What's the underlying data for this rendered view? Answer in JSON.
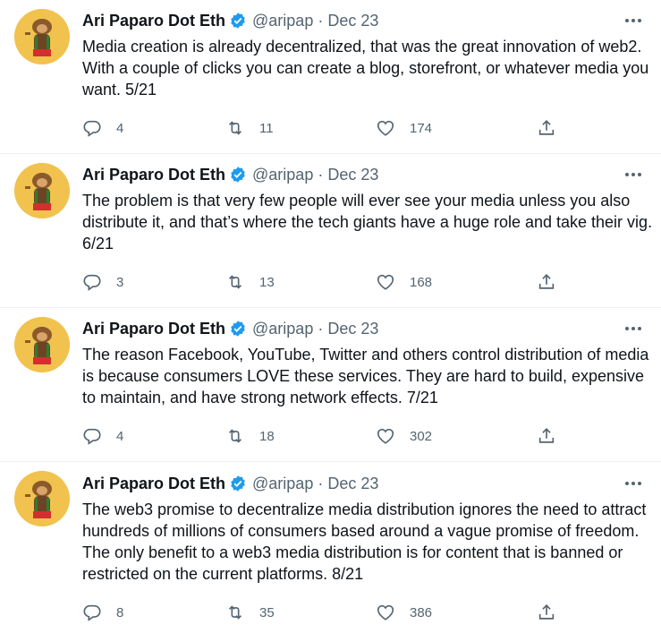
{
  "tweets": [
    {
      "name": "Ari Paparo Dot Eth",
      "handle": "@aripap",
      "separator": "·",
      "date": "Dec 23",
      "text": "Media creation is already decentralized, that was the great innovation of web2. With a couple of clicks you can create a blog, storefront, or whatever media you want. 5/21",
      "replies": "4",
      "retweets": "11",
      "likes": "174"
    },
    {
      "name": "Ari Paparo Dot Eth",
      "handle": "@aripap",
      "separator": "·",
      "date": "Dec 23",
      "text": "The problem is that very few people will ever see your media unless you also distribute it, and that’s where the tech giants have a huge role and take their vig. 6/21",
      "replies": "3",
      "retweets": "13",
      "likes": "168"
    },
    {
      "name": "Ari Paparo Dot Eth",
      "handle": "@aripap",
      "separator": "·",
      "date": "Dec 23",
      "text": "The reason Facebook, YouTube, Twitter and others control distribution of media is because consumers LOVE these services. They are hard to build, expensive to maintain, and have strong network effects. 7/21",
      "replies": "4",
      "retweets": "18",
      "likes": "302"
    },
    {
      "name": "Ari Paparo Dot Eth",
      "handle": "@aripap",
      "separator": "·",
      "date": "Dec 23",
      "text": "The web3 promise to decentralize media distribution  ignores the need to attract hundreds of millions of consumers based around a vague promise of freedom. The only benefit to a web3 media distribution is for content that is banned or restricted on the current platforms. 8/21",
      "replies": "8",
      "retweets": "35",
      "likes": "386"
    }
  ],
  "icons": {
    "verified": "verified-badge-icon",
    "more": "more-horizontal-icon",
    "reply": "reply-icon",
    "retweet": "retweet-icon",
    "like": "heart-icon",
    "share": "share-icon"
  },
  "colors": {
    "text": "#0f1419",
    "secondary": "#536471",
    "verified": "#1d9bf0",
    "avatar_bg": "#f2c24f"
  }
}
